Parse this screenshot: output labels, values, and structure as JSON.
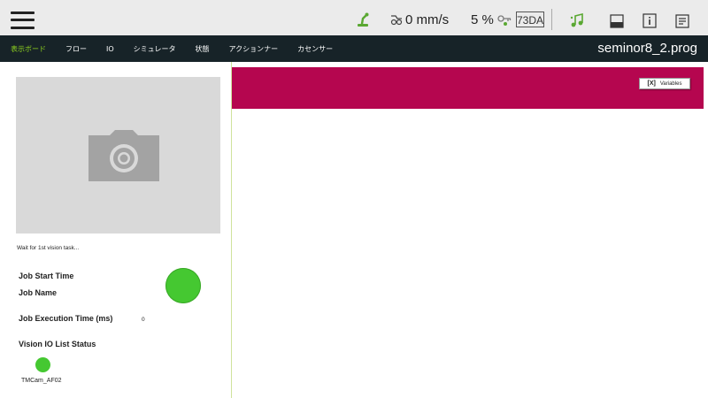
{
  "topbar": {
    "speed": "0 mm/s",
    "percent": "5 %",
    "code": "73DA",
    "icons": [
      "menu-icon",
      "robot-arm-icon",
      "speed-icon",
      "key-icon",
      "music-note-icon",
      "panel-icon",
      "info-icon",
      "document-icon"
    ]
  },
  "nav": {
    "tabs": [
      {
        "label": "表示ボード",
        "active": true
      },
      {
        "label": "フロー"
      },
      {
        "label": "IO"
      },
      {
        "label": "シミュレータ"
      },
      {
        "label": "状態"
      },
      {
        "label": "アクションナー"
      },
      {
        "label": "カセンサー"
      }
    ],
    "filename": "seminor8_2.prog"
  },
  "vision": {
    "wait_text": "Wait for 1st vision task...",
    "job_start_time_label": "Job Start Time",
    "job_name_label": "Job Name",
    "job_exec_time_label": "Job Execution Time (ms)",
    "job_exec_time_value": "0",
    "io_status_label": "Vision IO List Status",
    "camera_name": "TMCam_AF02"
  },
  "variables_button": {
    "icon": "[X]",
    "label": "Variables"
  },
  "colors": {
    "accent_magenta": "#b5064f",
    "status_green": "#45c831",
    "nav_bg": "#172328",
    "active_tab": "#8ed11f"
  }
}
